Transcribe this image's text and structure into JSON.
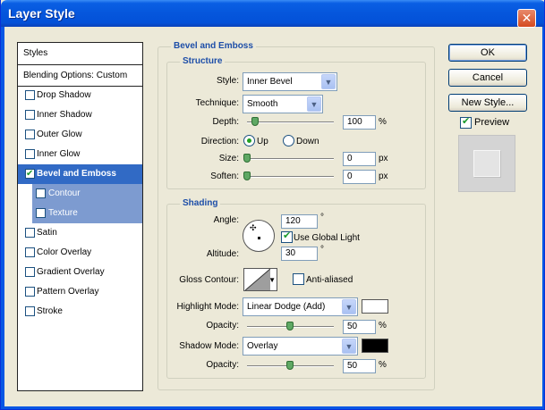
{
  "window": {
    "title": "Layer Style",
    "close_glyph": "✕"
  },
  "sidebar": {
    "items": [
      {
        "label": "Styles"
      },
      {
        "label": "Blending Options: Custom"
      },
      {
        "label": "Drop Shadow",
        "checked": false
      },
      {
        "label": "Inner Shadow",
        "checked": false
      },
      {
        "label": "Outer Glow",
        "checked": false
      },
      {
        "label": "Inner Glow",
        "checked": false
      },
      {
        "label": "Bevel and Emboss",
        "checked": true
      },
      {
        "label": "Contour",
        "checked": false
      },
      {
        "label": "Texture",
        "checked": false
      },
      {
        "label": "Satin",
        "checked": false
      },
      {
        "label": "Color Overlay",
        "checked": false
      },
      {
        "label": "Gradient Overlay",
        "checked": false
      },
      {
        "label": "Pattern Overlay",
        "checked": false
      },
      {
        "label": "Stroke",
        "checked": false
      }
    ]
  },
  "bevel": {
    "title": "Bevel and Emboss",
    "structure": {
      "title": "Structure",
      "style_label": "Style:",
      "style_value": "Inner Bevel",
      "technique_label": "Technique:",
      "technique_value": "Smooth",
      "depth_label": "Depth:",
      "depth_value": "100",
      "depth_unit": "%",
      "direction_label": "Direction:",
      "direction_up": "Up",
      "direction_down": "Down",
      "size_label": "Size:",
      "size_value": "0",
      "size_unit": "px",
      "soften_label": "Soften:",
      "soften_value": "0",
      "soften_unit": "px"
    },
    "shading": {
      "title": "Shading",
      "angle_label": "Angle:",
      "angle_value": "120",
      "angle_unit": "°",
      "global_light_label": "Use Global Light",
      "altitude_label": "Altitude:",
      "altitude_value": "30",
      "altitude_unit": "°",
      "gloss_label": "Gloss Contour:",
      "anti_aliased_label": "Anti-aliased",
      "highlight_label": "Highlight Mode:",
      "highlight_value": "Linear Dodge (Add)",
      "highlight_opacity_label": "Opacity:",
      "highlight_opacity_value": "50",
      "highlight_color": "#ffffff",
      "shadow_label": "Shadow Mode:",
      "shadow_value": "Overlay",
      "shadow_opacity_label": "Opacity:",
      "shadow_opacity_value": "50",
      "shadow_color": "#000000",
      "percent": "%"
    }
  },
  "buttons": {
    "ok": "OK",
    "cancel": "Cancel",
    "new_style": "New Style...",
    "preview": "Preview"
  },
  "colors": {
    "title_blue": "#0556dc",
    "selection": "#316ac5",
    "sub_selection": "#7d9bd0",
    "group_title": "#1d4ea8"
  }
}
